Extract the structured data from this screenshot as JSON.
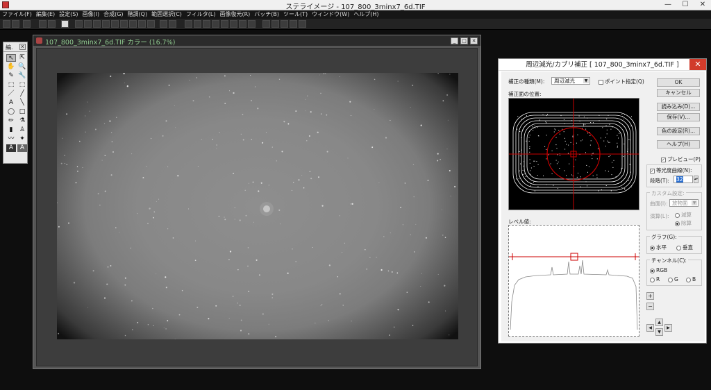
{
  "app": {
    "title": "ステライメージ - 107_800_3minx7_6d.TIF",
    "min": "—",
    "max": "☐",
    "close": "✕"
  },
  "menu": [
    "ファイル(F)",
    "編集(E)",
    "設定(S)",
    "画像(I)",
    "合成(G)",
    "階調(Q)",
    "範囲選択(C)",
    "フィルタ(L)",
    "画像復元(R)",
    "バッチ(B)",
    "ツール(T)",
    "ウィンドウ(W)",
    "ヘルプ(H)"
  ],
  "toolpalette": {
    "title": "編.",
    "close": "x",
    "tools": [
      "↖",
      "⇱",
      "✋",
      "🔍",
      "✎",
      "🔧",
      "⬚",
      "⬚",
      "／",
      "╱",
      "A",
      "╲",
      "◯",
      "□",
      "✏",
      "⚗",
      "▮",
      "♙",
      "〰",
      "✦",
      "A",
      "A"
    ]
  },
  "image_window": {
    "title": "107_800_3minx7_6d.TIF カラー (16.7%)",
    "min": "_",
    "max": "□",
    "close": "✕"
  },
  "dialog": {
    "title": "周辺減光/カブリ補正 [ 107_800_3minx7_6d.TIF ]",
    "close": "✕",
    "correction_type_label": "補正の種類(M):",
    "correction_type_value": "周辺減光",
    "point_spec_label": "ポイント指定(Q)",
    "plane_position_label": "補正面の位置:",
    "level_label": "レベル値:",
    "buttons": {
      "ok": "OK",
      "cancel": "キャンセル",
      "load": "読み込み(D)...",
      "save": "保存(V)...",
      "color": "色の設定(R)...",
      "help": "ヘルプ(H)"
    },
    "preview_label": "プレビュー(P)",
    "isophote_label": "等光度曲線(N):",
    "steps_label": "段階(T):",
    "steps_value": "32",
    "custom_label": "カスタム設定:",
    "surface_label": "曲面(I):",
    "surface_value": "放物面",
    "calc_label": "演算(L):",
    "calc_options": [
      "減算",
      "除算"
    ],
    "graph_label": "グラフ(G):",
    "graph_options": [
      "水平",
      "垂直"
    ],
    "channel_label": "チャンネル(C):",
    "channel_options": [
      "RGB",
      "R",
      "G",
      "B"
    ],
    "plus": "+",
    "minus": "−",
    "arrows": {
      "left": "◀",
      "up": "▲",
      "down": "▼",
      "right": "▶"
    }
  }
}
